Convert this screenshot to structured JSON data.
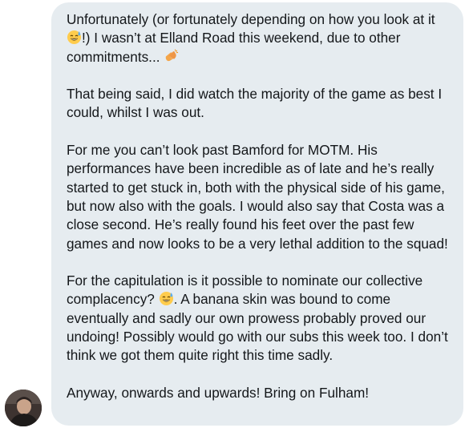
{
  "message": {
    "p1_a": "Unfortunately (or fortunately depending on how you look at it",
    "p1_emoji1": "sweat-smile-emoji",
    "p1_b": "!) I wasn’t at Elland Road this weekend, due to other commitments...",
    "p1_emoji2": "clapping-hands-emoji",
    "p2": "That being said, I did watch the majority of the game as best I could, whilst I was out.",
    "p3": "For me you can’t look past Bamford for MOTM. His performances have been incredible as of late and he’s really started to get stuck in, both with the physical side of his game, but now also with the goals. I would also say that Costa was a close second. He’s really found his feet over the past few games and now looks to be a very lethal addition to the squad!",
    "p4_a": "For the capitulation is it possible to nominate our collective complacency?",
    "p4_emoji": "sweat-smile-emoji",
    "p4_b": ". A banana skin was bound to come eventually and sadly our own prowess probably proved our undoing! Possibly would go with our subs this week too. I don’t think we got them quite right this time sadly.",
    "p5": "Anyway, onwards and upwards! Bring on Fulham!"
  },
  "colors": {
    "bubble_background": "#e6ecf0",
    "text": "#14171a",
    "emoji_face": "#ffcc4d",
    "emoji_sweat": "#5dadec",
    "emoji_hands": "#f4a64a"
  }
}
